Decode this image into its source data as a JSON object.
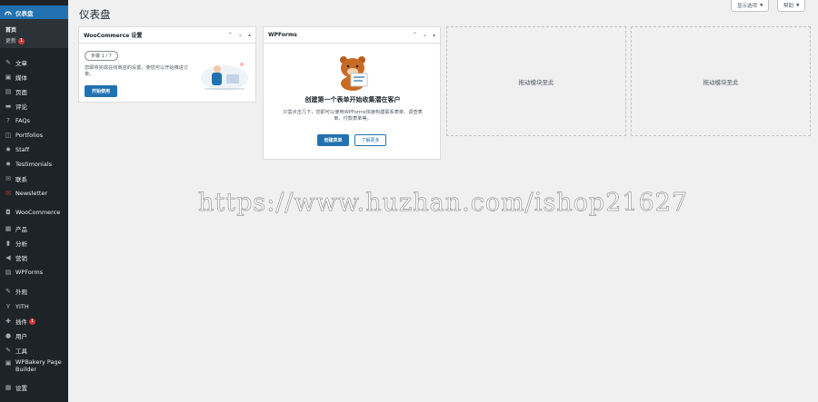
{
  "sidebar": {
    "dashboard": {
      "label": "仪表盘"
    },
    "submenu": {
      "home": "首页",
      "updates": "更新",
      "updates_badge": "1"
    },
    "items": [
      {
        "label": "文章",
        "icon": "pin-icon"
      },
      {
        "label": "媒体",
        "icon": "media-icon"
      },
      {
        "label": "页面",
        "icon": "page-icon"
      },
      {
        "label": "评论",
        "icon": "comment-icon"
      },
      {
        "label": "FAQs",
        "icon": "faq-icon"
      },
      {
        "label": "Portfolios",
        "icon": "portfolio-icon"
      },
      {
        "label": "Staff",
        "icon": "staff-icon"
      },
      {
        "label": "Testimonials",
        "icon": "testimonial-icon"
      },
      {
        "label": "联系",
        "icon": "mail-icon"
      },
      {
        "label": "Newsletter",
        "icon": "newsletter-icon"
      },
      {
        "label": "WooCommerce",
        "icon": "woo-icon"
      },
      {
        "label": "产品",
        "icon": "archive-icon"
      },
      {
        "label": "分析",
        "icon": "chart-icon"
      },
      {
        "label": "营销",
        "icon": "megaphone-icon"
      },
      {
        "label": "WPForms",
        "icon": "forms-icon"
      },
      {
        "label": "外观",
        "icon": "brush-icon"
      },
      {
        "label": "YITH",
        "icon": "yith-icon"
      },
      {
        "label": "插件",
        "icon": "plugin-icon",
        "badge": "1"
      },
      {
        "label": "用户",
        "icon": "user-icon"
      },
      {
        "label": "工具",
        "icon": "wrench-icon"
      },
      {
        "label": "WPBakery Page Builder",
        "icon": "builder-icon"
      },
      {
        "label": "设置",
        "icon": "settings-icon"
      }
    ]
  },
  "main": {
    "title": "仪表盘",
    "screen_options": "显示选项",
    "help": "帮助"
  },
  "widgets": {
    "woocommerce": {
      "title": "WooCommerce 设置",
      "step": "步骤 1 / 7",
      "text": "您即将完成在线商店的设置，使您可以开始推进订单。",
      "button": "开始使用"
    },
    "wpforms": {
      "title": "WPForms",
      "heading": "创建第一个表单开始收集潜在客户",
      "text": "只需点击几下，您即可以使用WPForms快速构建联系表单、调查表单、付款表单等。",
      "create_button": "创建表单",
      "learn_button": "了解更多"
    },
    "drop_zone_1": "拖动模块至此",
    "drop_zone_2": "拖动模块至此"
  },
  "watermark": "https://www.huzhan.com/ishop21627",
  "colors": {
    "sidebar": "#1d2327",
    "accent": "#2271b1",
    "badge": "#d63638",
    "page_bg": "#f0f0f1"
  }
}
